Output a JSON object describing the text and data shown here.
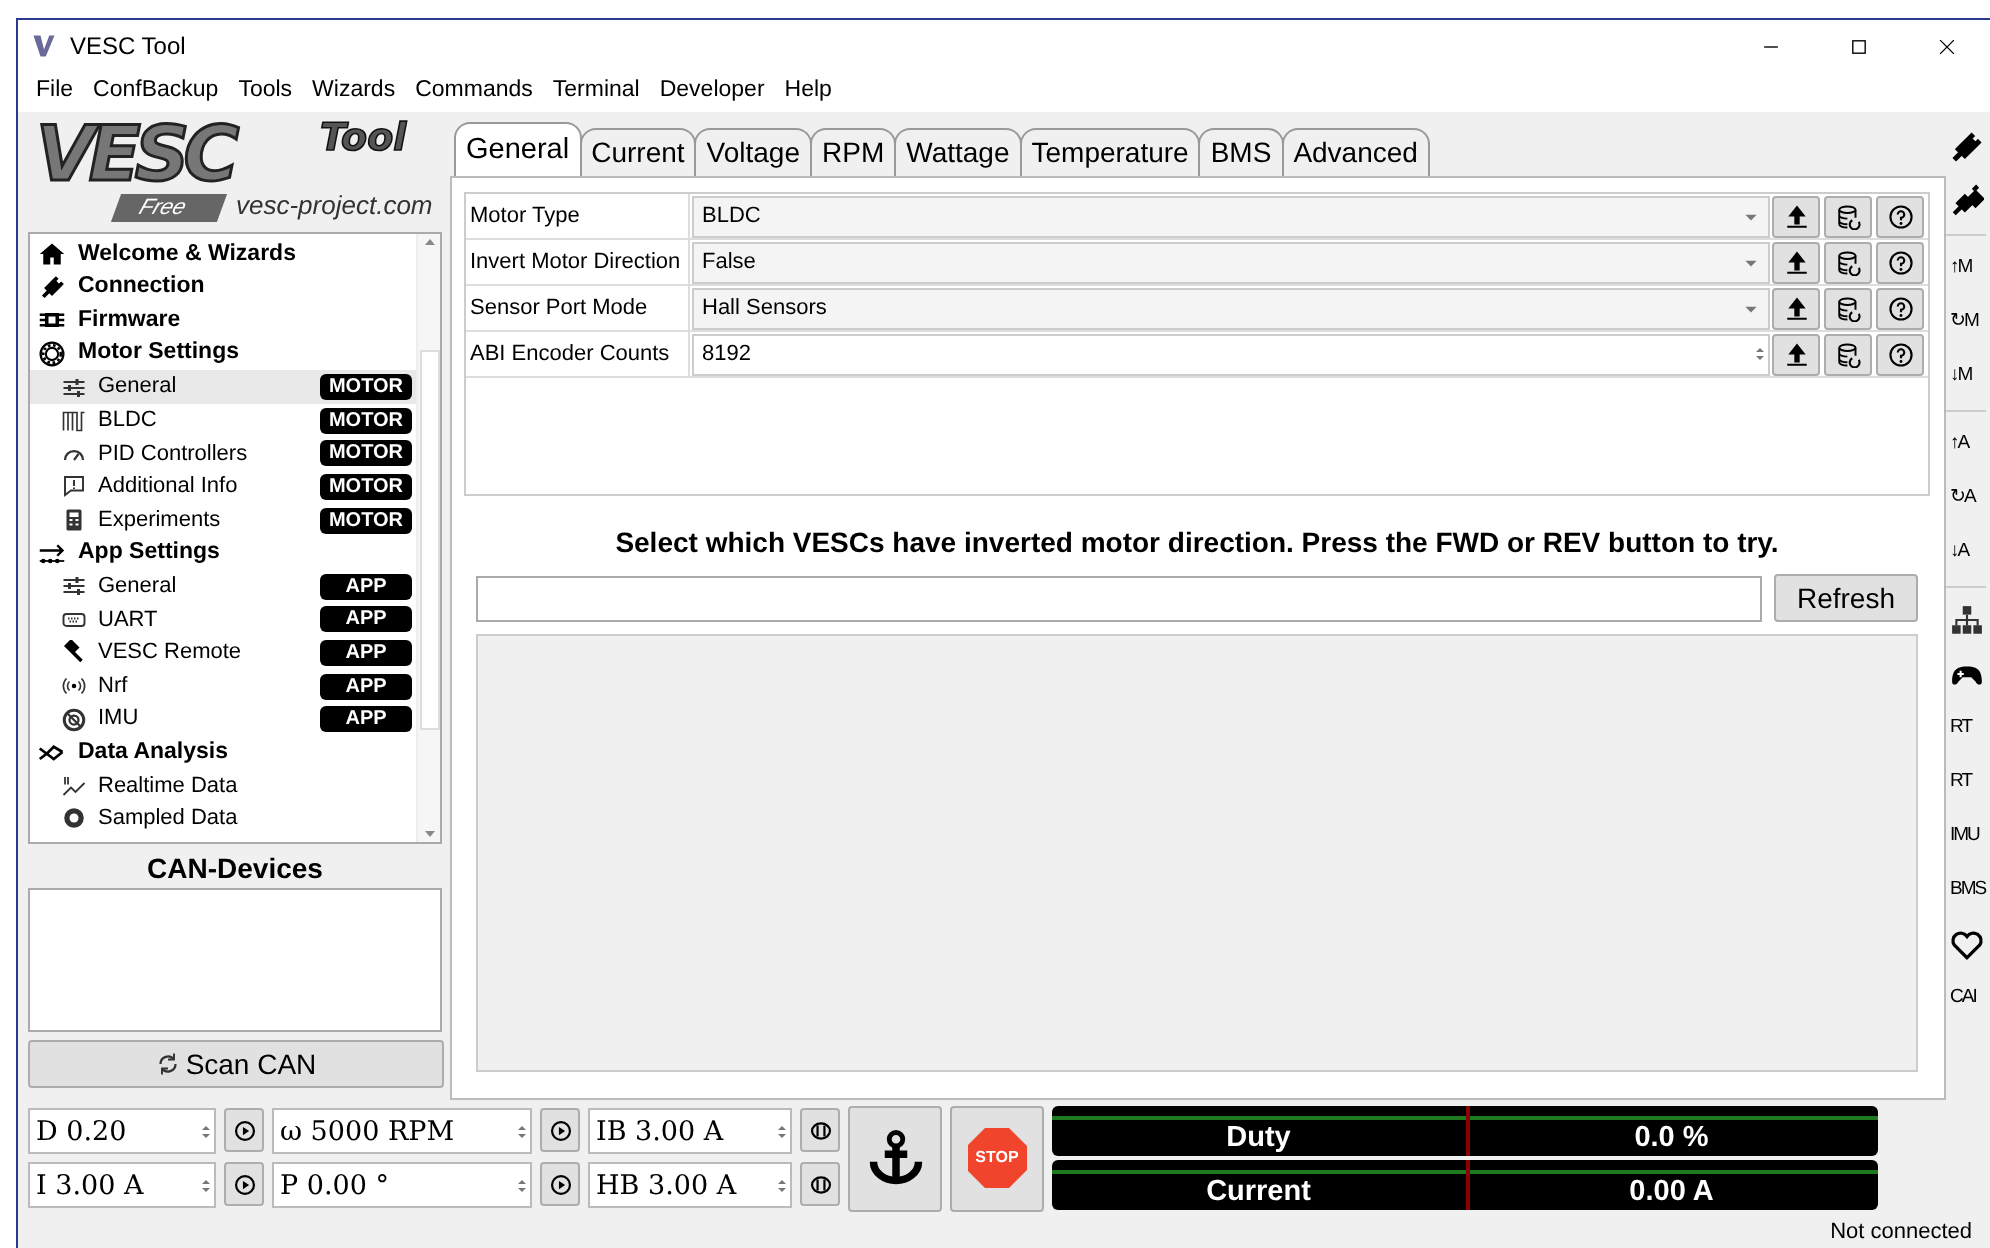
{
  "window": {
    "title": "VESC Tool"
  },
  "menu": [
    "File",
    "ConfBackup",
    "Tools",
    "Wizards",
    "Commands",
    "Terminal",
    "Developer",
    "Help"
  ],
  "logo": {
    "title": "VESC",
    "product": "Tool",
    "edition": "Free",
    "site": "vesc-project.com"
  },
  "tree": [
    {
      "kind": "category",
      "label": "Welcome & Wizards",
      "selected": false
    },
    {
      "kind": "category",
      "label": "Connection",
      "selected": false
    },
    {
      "kind": "category",
      "label": "Firmware",
      "selected": false
    },
    {
      "kind": "category",
      "label": "Motor Settings",
      "selected": false
    },
    {
      "kind": "page",
      "label": "General",
      "badge": "MOTOR",
      "selected": true
    },
    {
      "kind": "page",
      "label": "BLDC",
      "badge": "MOTOR",
      "selected": false
    },
    {
      "kind": "page",
      "label": "PID Controllers",
      "badge": "MOTOR",
      "selected": false
    },
    {
      "kind": "page",
      "label": "Additional Info",
      "badge": "MOTOR",
      "selected": false
    },
    {
      "kind": "page",
      "label": "Experiments",
      "badge": "MOTOR",
      "selected": false
    },
    {
      "kind": "category",
      "label": "App Settings",
      "selected": false
    },
    {
      "kind": "page",
      "label": "General",
      "badge": "APP",
      "selected": false
    },
    {
      "kind": "page",
      "label": "UART",
      "badge": "APP",
      "selected": false
    },
    {
      "kind": "page",
      "label": "VESC Remote",
      "badge": "APP",
      "selected": false
    },
    {
      "kind": "page",
      "label": "Nrf",
      "badge": "APP",
      "selected": false
    },
    {
      "kind": "page",
      "label": "IMU",
      "badge": "APP",
      "selected": false
    },
    {
      "kind": "category",
      "label": "Data Analysis",
      "selected": false
    },
    {
      "kind": "page",
      "label": "Realtime Data",
      "selected": false
    },
    {
      "kind": "page",
      "label": "Sampled Data",
      "selected": false
    }
  ],
  "can_devices": {
    "title": "CAN-Devices",
    "scan_button": "Scan CAN"
  },
  "tabs": [
    {
      "label": "General",
      "selected": true
    },
    {
      "label": "Current",
      "selected": false
    },
    {
      "label": "Voltage",
      "selected": false
    },
    {
      "label": "RPM",
      "selected": false
    },
    {
      "label": "Wattage",
      "selected": false
    },
    {
      "label": "Temperature",
      "selected": false
    },
    {
      "label": "BMS",
      "selected": false
    },
    {
      "label": "Advanced",
      "selected": false
    }
  ],
  "parameters": [
    {
      "label": "Motor Type",
      "kind": "combo",
      "value": "BLDC"
    },
    {
      "label": "Invert Motor Direction",
      "kind": "combo",
      "value": "False"
    },
    {
      "label": "Sensor Port Mode",
      "kind": "combo",
      "value": "Hall Sensors"
    },
    {
      "label": "ABI Encoder Counts",
      "kind": "spin",
      "value": "8192"
    }
  ],
  "direction": {
    "instruction": "Select which VESCs have inverted motor direction. Press the FWD or REV button to try.",
    "refresh_button": "Refresh"
  },
  "controls": [
    {
      "value": "D 0.20",
      "kind": "play"
    },
    {
      "value": "ω 5000 RPM",
      "kind": "play"
    },
    {
      "value": "IB 3.00 A",
      "kind": "brake"
    },
    {
      "value": "I 3.00 A",
      "kind": "play"
    },
    {
      "value": "P 0.00 °",
      "kind": "play"
    },
    {
      "value": "HB 3.00 A",
      "kind": "brake"
    }
  ],
  "stop_button": "STOP",
  "meters": [
    {
      "label": "Duty",
      "reading": "0.0 %"
    },
    {
      "label": "Current",
      "reading": "0.00 A"
    }
  ],
  "toolbar": [
    {
      "kind": "icon"
    },
    {
      "kind": "icon"
    },
    {
      "kind": "separator"
    },
    {
      "kind": "text",
      "label": "↑M"
    },
    {
      "kind": "text",
      "label": "↻M"
    },
    {
      "kind": "text",
      "label": "↓M"
    },
    {
      "kind": "separator"
    },
    {
      "kind": "text",
      "label": "↑A"
    },
    {
      "kind": "text",
      "label": "↻A"
    },
    {
      "kind": "text",
      "label": "↓A"
    },
    {
      "kind": "separator"
    },
    {
      "kind": "icon"
    },
    {
      "kind": "icon"
    },
    {
      "kind": "text",
      "label": "RT"
    },
    {
      "kind": "text",
      "label": "RT"
    },
    {
      "kind": "text",
      "label": "IMU"
    },
    {
      "kind": "text",
      "label": "BMS"
    },
    {
      "kind": "icon"
    },
    {
      "kind": "text",
      "label": "CAI"
    }
  ],
  "status_bar": "Not connected"
}
